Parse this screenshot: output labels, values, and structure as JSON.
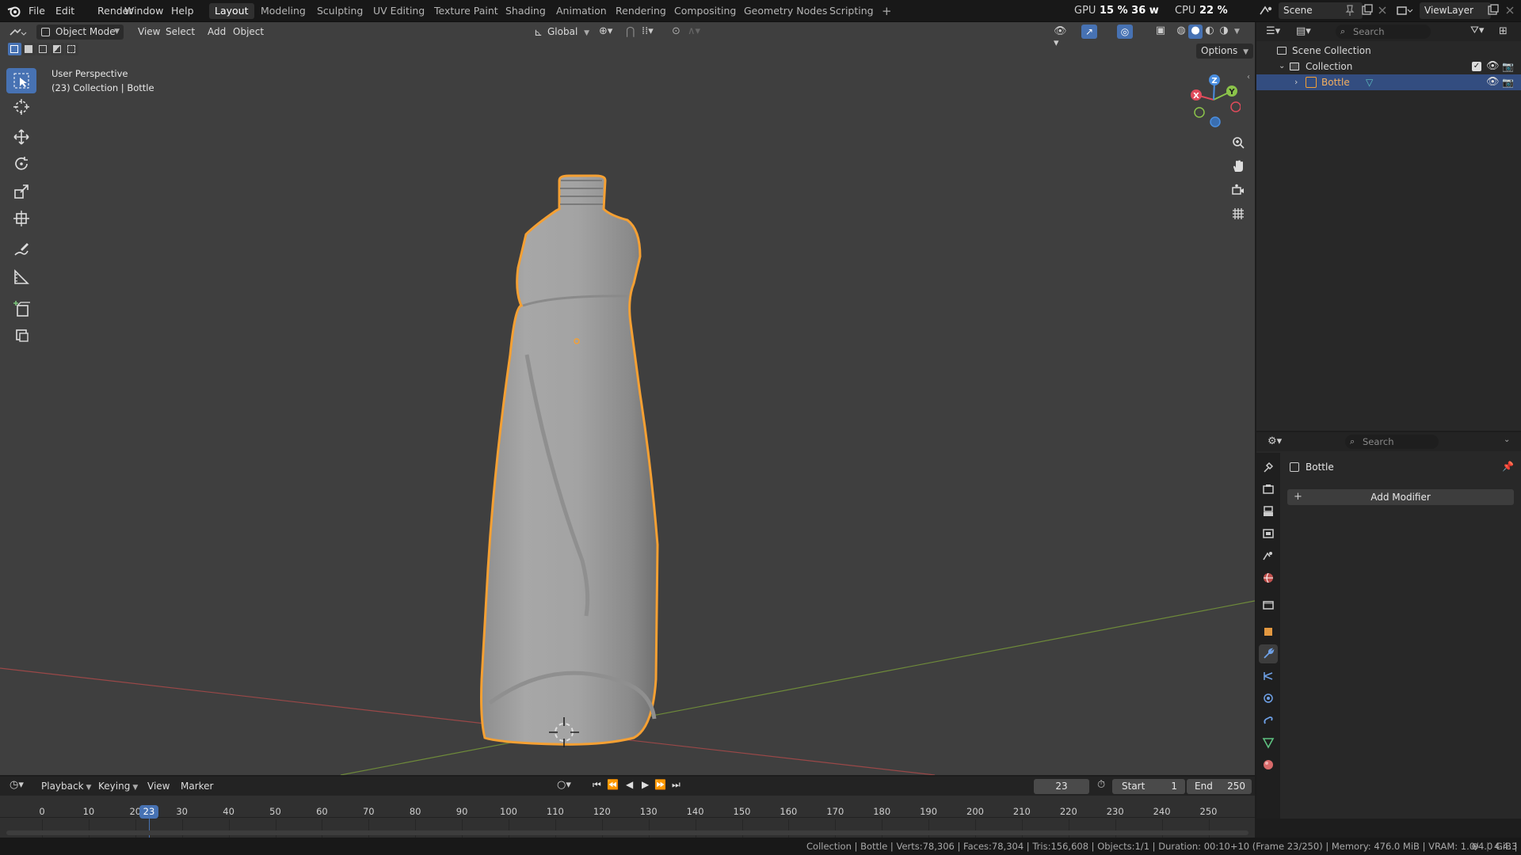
{
  "app": {
    "menus": [
      "File",
      "Edit",
      "Render",
      "Window",
      "Help"
    ],
    "workspaces": [
      "Layout",
      "Modeling",
      "Sculpting",
      "UV Editing",
      "Texture Paint",
      "Shading",
      "Animation",
      "Rendering",
      "Compositing",
      "Geometry Nodes",
      "Scripting"
    ],
    "active_workspace": "Layout",
    "add_workspace": "+",
    "gpu_label": "GPU",
    "gpu_value": "15 %",
    "gpu_power": "36 w",
    "cpu_label": "CPU",
    "cpu_value": "22 %",
    "scene_name": "Scene",
    "view_layer_name": "ViewLayer"
  },
  "viewport": {
    "mode": "Object Mode",
    "header_menus": [
      "View",
      "Select",
      "Add",
      "Object"
    ],
    "transform_orientation": "Global",
    "options_label": "Options",
    "overlay_title": "User Perspective",
    "overlay_subtitle": "(23) Collection | Bottle",
    "gizmo_axes": [
      "X",
      "Y",
      "Z"
    ],
    "accent": "#4772b3",
    "selection_outline": "#f5a033"
  },
  "outliner": {
    "search_placeholder": "Search",
    "scene_collection": "Scene Collection",
    "collection": "Collection",
    "object": "Bottle"
  },
  "properties": {
    "search_placeholder": "Search",
    "object_name": "Bottle",
    "add_modifier": "Add Modifier",
    "add_modifier_icon": "+"
  },
  "timeline": {
    "menus": [
      "Playback",
      "Keying",
      "View",
      "Marker"
    ],
    "current_frame": "23",
    "start_label": "Start",
    "start": "1",
    "end_label": "End",
    "end": "250",
    "ticks": [
      "0",
      "10",
      "20",
      "30",
      "40",
      "50",
      "60",
      "70",
      "80",
      "90",
      "100",
      "110",
      "120",
      "130",
      "140",
      "150",
      "160",
      "170",
      "180",
      "190",
      "200",
      "210",
      "220",
      "230",
      "240",
      "250"
    ],
    "playhead_label": "23"
  },
  "status": {
    "text": "Collection | Bottle | Verts:78,306 | Faces:78,304 | Tris:156,608 | Objects:1/1 | Duration: 00:10+10 (Frame 23/250) | Memory: 476.0 MiB | VRAM: 1.0/4.0 GiB |",
    "version": "4.4.3"
  }
}
